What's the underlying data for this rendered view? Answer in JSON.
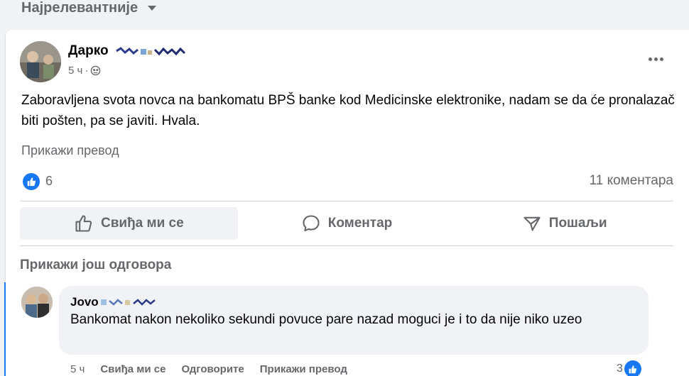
{
  "sort": {
    "label": "Најрелевантније"
  },
  "post": {
    "author": "Дарко",
    "time": "5 ч",
    "dot": "·",
    "text": "Zaboravljena svota novca na bankomatu BPŠ banke kod Medicinske elektronike, nadam se da će pronalazač biti pošten, pa se javiti. Hvala.",
    "translate_label": "Прикажи превод",
    "reactions": {
      "like_count": "6",
      "comments_label": "11 коментара"
    },
    "actions": {
      "like": "Свиђа ми се",
      "comment": "Коментар",
      "share": "Пошаљи"
    }
  },
  "replies": {
    "more_label": "Прикажи још одговора",
    "comment": {
      "author": "Jovo",
      "text": "Bankomat nakon nekoliko sekundi povuce pare nazad moguci je i to da nije niko uzeo",
      "time": "5 ч",
      "like": "Свиђа ми се",
      "reply": "Одговорите",
      "translate": "Прикажи превод",
      "reaction_count": "3"
    }
  },
  "colors": {
    "accent": "#1877f2",
    "secondary_text": "#65676b",
    "surface": "#f0f2f5"
  },
  "icons": [
    "chevron-down-icon",
    "globe-icon",
    "more-icon",
    "like-icon",
    "comment-icon",
    "share-icon"
  ]
}
